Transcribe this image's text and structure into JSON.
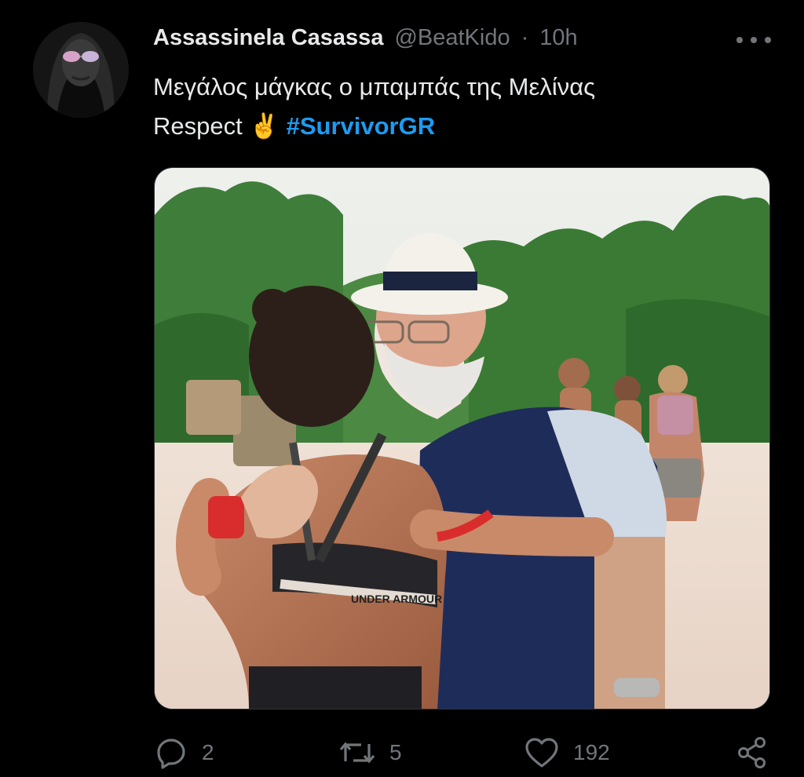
{
  "tweet": {
    "display_name": "Assassinela Casassa",
    "handle": "@BeatKido",
    "separator": "·",
    "time": "10h",
    "text_line1": "Μεγάλος μάγκας ο μπαμπάς της Μελίνας",
    "text_line2": "Respect",
    "emoji": "✌️",
    "hashtag": "#SurvivorGR",
    "image_shirt_text": "UNDER ARMOUR"
  },
  "actions": {
    "replies": "2",
    "retweets": "5",
    "likes": "192"
  },
  "icons": {
    "avatar": "avatar",
    "more": "more-icon",
    "reply": "reply-icon",
    "retweet": "retweet-icon",
    "like": "heart-icon",
    "share": "share-icon"
  },
  "colors": {
    "background": "#000000",
    "text": "#e7e9ea",
    "muted": "#71767b",
    "link": "#1d9bf0"
  }
}
